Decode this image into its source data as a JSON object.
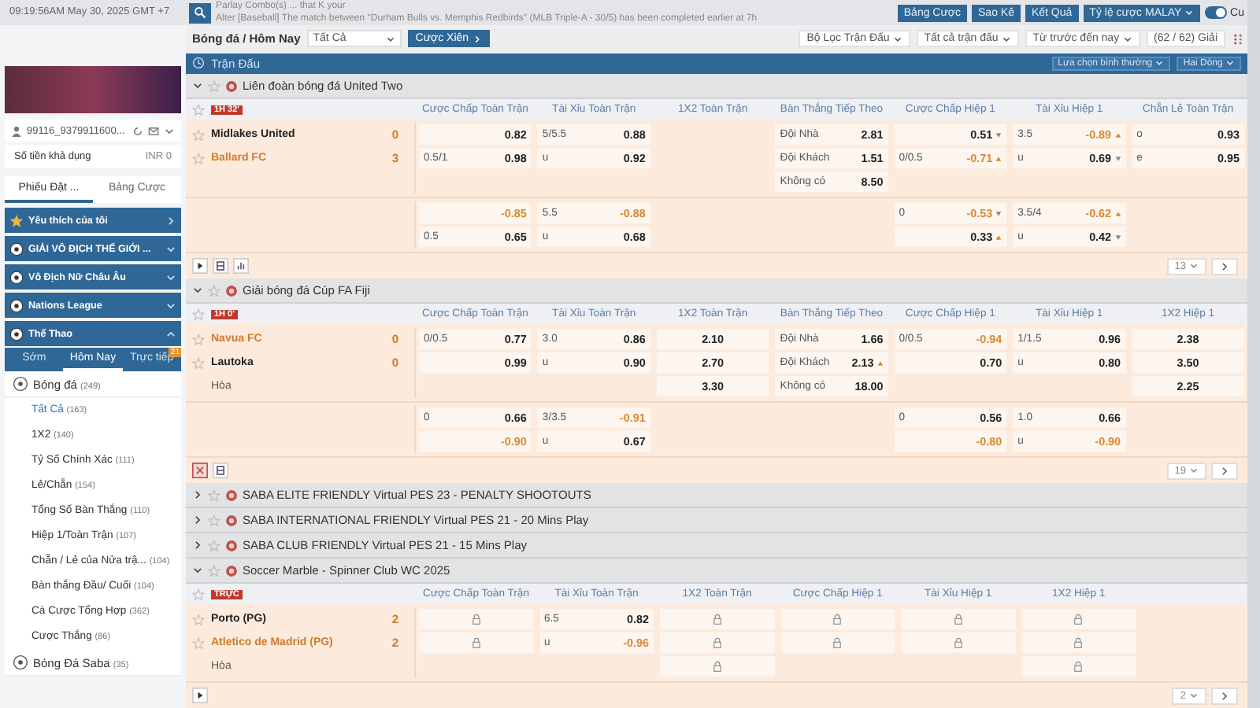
{
  "top_bar": {
    "clock": "09:19:56AM May 30, 2025 GMT +7",
    "ticker": [
      "Parlay Combo(s) ... that K your",
      "Alter [Baseball] The match between \"Durham Bulls vs. Memphis Redbirds\" (MLB Triple-A - 30/5) has been completed earlier at 7h"
    ],
    "buttons": [
      "Bảng Cược",
      "Sao Kê",
      "Kết Quả"
    ],
    "odds_format": "Tỷ lệ cược MALAY",
    "toggle": {
      "label": "Cu",
      "on": true
    }
  },
  "sidebar": {
    "user": "99116_9379911600...",
    "balance_label": "Số tiền khả dụng",
    "balance": "INR 0",
    "tabs": [
      {
        "label": "Phiếu Đặt ...",
        "selected": true
      },
      {
        "label": "Bảng Cược",
        "selected": false
      }
    ],
    "menu": [
      {
        "kind": "favorite",
        "label": "Yêu thích của tôi"
      },
      {
        "kind": "league",
        "label": "GIẢI VÔ ĐỊCH THẾ GIỚI ...",
        "expanded": false
      },
      {
        "kind": "league",
        "label": "Vô Địch Nữ Châu Âu",
        "expanded": false
      },
      {
        "kind": "league",
        "label": "Nations League",
        "expanded": false
      },
      {
        "kind": "league",
        "label": "Thể Thao",
        "expanded": true
      }
    ],
    "periods": [
      {
        "label": "Sớm",
        "selected": false
      },
      {
        "label": "Hôm Nay",
        "selected": true
      },
      {
        "label": "Trực tiếp",
        "selected": false,
        "badge": "21"
      }
    ],
    "sports": [
      {
        "label": "Bóng đá",
        "count": "(249)",
        "children": [
          {
            "label": "Tất Cả",
            "count": "(163)",
            "selected": true
          },
          {
            "label": "1X2",
            "count": "(140)",
            "selected": false
          },
          {
            "label": "Tỷ Số Chính Xác",
            "count": "(111)",
            "selected": false
          },
          {
            "label": "Lẻ/Chẵn",
            "count": "(154)",
            "selected": false
          },
          {
            "label": "Tổng Số Bàn Thắng",
            "count": "(110)",
            "selected": false
          },
          {
            "label": "Hiệp 1/Toàn Trận",
            "count": "(107)",
            "selected": false
          },
          {
            "label": "Chẵn / Lẻ của Nửa trậ...",
            "count": "(104)",
            "selected": false
          },
          {
            "label": "Bàn thắng Đầu/ Cuối",
            "count": "(104)",
            "selected": false
          },
          {
            "label": "Cá Cược Tổng Hợp",
            "count": "(362)",
            "selected": false
          },
          {
            "label": "Cược Thắng",
            "count": "(86)",
            "selected": false
          }
        ]
      },
      {
        "label": "Bóng Đá Saba",
        "count": "(35)"
      }
    ]
  },
  "main": {
    "breadcrumb": "Bóng đá / Hôm Nay",
    "market_filter": "Tất Cả",
    "parlay_button": "Cược Xiên",
    "filters": [
      "Bộ Lọc Trận Đấu",
      "Tất cả trận đấu",
      "Từ trước đến nay"
    ],
    "league_count": "(62 / 62) Giải",
    "section_title": "Trận Đấu",
    "view_options": [
      "Lựa chọn bình thường",
      "Hai Dòng"
    ],
    "leagues": [
      {
        "name": "Liên đoàn bóng đá United Two",
        "expanded": true,
        "columns": [
          {
            "kind": "handicap",
            "label": "Cược Chấp Toàn Trận"
          },
          {
            "kind": "total",
            "label": "Tài Xỉu Toàn Trận"
          },
          {
            "kind": "x12",
            "label": "1X2 Toàn Trận"
          },
          {
            "kind": "next_goal",
            "label": "Bàn Thắng Tiếp Theo"
          },
          {
            "kind": "handicap_h1",
            "label": "Cược Chấp Hiệp 1"
          },
          {
            "kind": "total_h1",
            "label": "Tài Xỉu Hiệp 1"
          },
          {
            "kind": "odd_even",
            "label": "Chẵn Lẻ Toàn Trận"
          }
        ],
        "match": {
          "status": "1H 32'",
          "teams": [
            {
              "name": "Midlakes United",
              "score": "0",
              "highlighted": false
            },
            {
              "name": "Ballard FC",
              "score": "3",
              "highlighted": true
            }
          ],
          "lines": [
            [
              {
                "handicap": {
                  "kind": "odds",
                  "odds": "0.82"
                },
                "total": {
                  "kind": "odds",
                  "line": "5/5.5",
                  "odds": "0.88"
                },
                "next_goal": {
                  "kind": "odds",
                  "line": "Đội Nhà",
                  "odds": "2.81"
                },
                "handicap_h1": {
                  "kind": "odds",
                  "odds": "0.51",
                  "rising": false
                },
                "total_h1": {
                  "kind": "odds",
                  "line": "3.5",
                  "odds": "-0.89",
                  "negative": true,
                  "rising": true
                },
                "odd_even": {
                  "kind": "odds",
                  "line": "o",
                  "odds": "0.93"
                }
              },
              {
                "handicap": {
                  "kind": "odds",
                  "line": "0.5/1",
                  "odds": "0.98"
                },
                "total": {
                  "kind": "odds",
                  "line": "u",
                  "odds": "0.92"
                },
                "next_goal": {
                  "kind": "odds",
                  "line": "Đội Khách",
                  "odds": "1.51"
                },
                "handicap_h1": {
                  "kind": "odds",
                  "line": "0/0.5",
                  "odds": "-0.71",
                  "negative": true,
                  "rising": true
                },
                "total_h1": {
                  "kind": "odds",
                  "line": "u",
                  "odds": "0.69",
                  "rising": false
                },
                "odd_even": {
                  "kind": "odds",
                  "line": "e",
                  "odds": "0.95"
                }
              },
              {
                "next_goal": {
                  "kind": "odds",
                  "line": "Không có",
                  "odds": "8.50"
                }
              }
            ],
            [
              {
                "handicap": {
                  "kind": "odds",
                  "odds": "-0.85",
                  "negative": true
                },
                "total": {
                  "kind": "odds",
                  "line": "5.5",
                  "odds": "-0.88",
                  "negative": true
                },
                "handicap_h1": {
                  "kind": "odds",
                  "line": "0",
                  "odds": "-0.53",
                  "negative": true,
                  "rising": false
                },
                "total_h1": {
                  "kind": "odds",
                  "line": "3.5/4",
                  "odds": "-0.62",
                  "negative": true,
                  "rising": true
                }
              },
              {
                "handicap": {
                  "kind": "odds",
                  "line": "0.5",
                  "odds": "0.65"
                },
                "total": {
                  "kind": "odds",
                  "line": "u",
                  "odds": "0.68"
                },
                "handicap_h1": {
                  "kind": "odds",
                  "odds": "0.33",
                  "rising": true
                },
                "total_h1": {
                  "kind": "odds",
                  "line": "u",
                  "odds": "0.42",
                  "rising": false
                }
              }
            ]
          ]
        },
        "tools": [
          {
            "kind": "play"
          },
          {
            "kind": "list"
          },
          {
            "kind": "chart"
          }
        ],
        "page": "13"
      },
      {
        "name": "Giải bóng đá Cúp FA Fiji",
        "expanded": true,
        "columns": [
          {
            "kind": "handicap",
            "label": "Cược Chấp Toàn Trận"
          },
          {
            "kind": "total",
            "label": "Tài Xỉu Toàn Trận"
          },
          {
            "kind": "x12",
            "label": "1X2 Toàn Trận"
          },
          {
            "kind": "next_goal",
            "label": "Bàn Thắng Tiếp Theo"
          },
          {
            "kind": "handicap_h1",
            "label": "Cược Chấp Hiệp 1"
          },
          {
            "kind": "total_h1",
            "label": "Tài Xỉu Hiệp 1"
          },
          {
            "kind": "x12_h1",
            "label": "1X2 Hiệp 1"
          }
        ],
        "match": {
          "status": "1H 0'",
          "teams": [
            {
              "name": "Navua FC",
              "score": "0",
              "highlighted": true
            },
            {
              "name": "Lautoka",
              "score": "0",
              "highlighted": false
            }
          ],
          "draw": "Hòa",
          "lines": [
            [
              {
                "handicap": {
                  "kind": "odds",
                  "line": "0/0.5",
                  "odds": "0.77"
                },
                "total": {
                  "kind": "odds",
                  "line": "3.0",
                  "odds": "0.86"
                },
                "x12": {
                  "kind": "price",
                  "odds": "2.10"
                },
                "next_goal": {
                  "kind": "odds",
                  "line": "Đội Nhà",
                  "odds": "1.66"
                },
                "handicap_h1": {
                  "kind": "odds",
                  "line": "0/0.5",
                  "odds": "-0.94",
                  "negative": true
                },
                "total_h1": {
                  "kind": "odds",
                  "line": "1/1.5",
                  "odds": "0.96"
                },
                "x12_h1": {
                  "kind": "price",
                  "odds": "2.38"
                }
              },
              {
                "handicap": {
                  "kind": "odds",
                  "odds": "0.99"
                },
                "total": {
                  "kind": "odds",
                  "line": "u",
                  "odds": "0.90"
                },
                "x12": {
                  "kind": "price",
                  "odds": "2.70"
                },
                "next_goal": {
                  "kind": "odds",
                  "line": "Đội Khách",
                  "odds": "2.13",
                  "rising": true
                },
                "handicap_h1": {
                  "kind": "odds",
                  "odds": "0.70"
                },
                "total_h1": {
                  "kind": "odds",
                  "line": "u",
                  "odds": "0.80"
                },
                "x12_h1": {
                  "kind": "price",
                  "odds": "3.50"
                }
              },
              {
                "x12": {
                  "kind": "price",
                  "odds": "3.30"
                },
                "next_goal": {
                  "kind": "odds",
                  "line": "Không có",
                  "odds": "18.00"
                },
                "x12_h1": {
                  "kind": "price",
                  "odds": "2.25"
                }
              }
            ],
            [
              {
                "handicap": {
                  "kind": "odds",
                  "line": "0",
                  "odds": "0.66"
                },
                "total": {
                  "kind": "odds",
                  "line": "3/3.5",
                  "odds": "-0.91",
                  "negative": true
                },
                "handicap_h1": {
                  "kind": "odds",
                  "line": "0",
                  "odds": "0.56"
                },
                "total_h1": {
                  "kind": "odds",
                  "line": "1.0",
                  "odds": "0.66"
                }
              },
              {
                "handicap": {
                  "kind": "odds",
                  "odds": "-0.90",
                  "negative": true
                },
                "total": {
                  "kind": "odds",
                  "line": "u",
                  "odds": "0.67"
                },
                "handicap_h1": {
                  "kind": "odds",
                  "odds": "-0.80",
                  "negative": true
                },
                "total_h1": {
                  "kind": "odds",
                  "line": "u",
                  "odds": "-0.90",
                  "negative": true
                }
              }
            ]
          ]
        },
        "tools": [
          {
            "kind": "close"
          },
          {
            "kind": "list"
          }
        ],
        "page": "19"
      },
      {
        "name": "SABA ELITE FRIENDLY Virtual PES 23 - PENALTY SHOOTOUTS",
        "expanded": false
      },
      {
        "name": "SABA INTERNATIONAL FRIENDLY Virtual PES 21 - 20 Mins Play",
        "expanded": false
      },
      {
        "name": "SABA CLUB FRIENDLY Virtual PES 21 - 15 Mins Play",
        "expanded": false
      },
      {
        "name": "Soccer Marble - Spinner Club WC 2025",
        "expanded": true,
        "columns": [
          {
            "kind": "handicap",
            "label": "Cược Chấp Toàn Trận"
          },
          {
            "kind": "total",
            "label": "Tài Xỉu Toàn Trận"
          },
          {
            "kind": "x12",
            "label": "1X2 Toàn Trận"
          },
          {
            "kind": "handicap_h1",
            "label": "Cược Chấp Hiệp 1"
          },
          {
            "kind": "total_h1",
            "label": "Tài Xỉu Hiệp 1"
          },
          {
            "kind": "x12_h1",
            "label": "1X2 Hiệp 1"
          }
        ],
        "match": {
          "status": "TRỰC",
          "teams": [
            {
              "name": "Porto (PG)",
              "score": "2",
              "highlighted": false
            },
            {
              "name": "Atletico de Madrid (PG)",
              "score": "2",
              "highlighted": true
            }
          ],
          "draw": "Hòa",
          "lines": [
            [
              {
                "handicap": {
                  "kind": "locked"
                },
                "total": {
                  "kind": "odds",
                  "line": "6.5",
                  "odds": "0.82"
                },
                "x12": {
                  "kind": "locked"
                },
                "handicap_h1": {
                  "kind": "locked"
                },
                "total_h1": {
                  "kind": "locked"
                },
                "x12_h1": {
                  "kind": "locked"
                }
              },
              {
                "handicap": {
                  "kind": "locked"
                },
                "total": {
                  "kind": "odds",
                  "line": "u",
                  "odds": "-0.96",
                  "negative": true
                },
                "x12": {
                  "kind": "locked"
                },
                "handicap_h1": {
                  "kind": "locked"
                },
                "total_h1": {
                  "kind": "locked"
                },
                "x12_h1": {
                  "kind": "locked"
                }
              },
              {
                "x12": {
                  "kind": "locked"
                },
                "x12_h1": {
                  "kind": "locked"
                }
              }
            ]
          ]
        },
        "tools": [
          {
            "kind": "play"
          }
        ],
        "page": "2"
      }
    ]
  }
}
